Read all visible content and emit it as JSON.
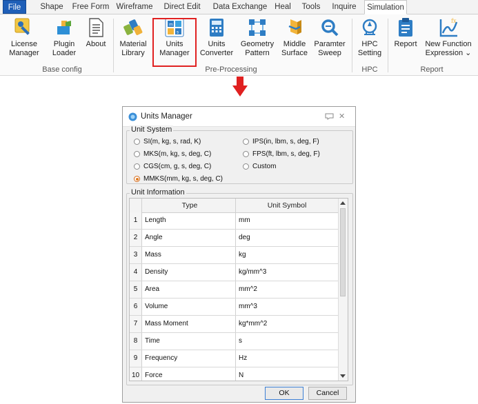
{
  "tabs": [
    "File",
    "Shape",
    "Free Form",
    "Wireframe",
    "Direct Edit",
    "Data Exchange",
    "Heal",
    "Tools",
    "Inquire",
    "Simulation"
  ],
  "active_tab": "Simulation",
  "ribbon": {
    "buttons": [
      {
        "name": "license-manager",
        "line1": "License",
        "line2": "Manager",
        "icon": "key-icon"
      },
      {
        "name": "plugin-loader",
        "line1": "Plugin",
        "line2": "Loader",
        "icon": "puzzle-icon"
      },
      {
        "name": "about",
        "line1": "About",
        "line2": "",
        "icon": "document-icon"
      },
      {
        "name": "material-library",
        "line1": "Material",
        "line2": "Library",
        "icon": "material-icon"
      },
      {
        "name": "units-manager",
        "line1": "Units",
        "line2": "Manager",
        "icon": "units-icon"
      },
      {
        "name": "units-converter",
        "line1": "Units",
        "line2": "Converter",
        "icon": "calculator-icon"
      },
      {
        "name": "geometry-pattern",
        "line1": "Geometry",
        "line2": "Pattern",
        "icon": "pattern-icon"
      },
      {
        "name": "middle-surface",
        "line1": "Middle",
        "line2": "Surface",
        "icon": "surface-icon"
      },
      {
        "name": "parameter-sweep",
        "line1": "Paramter",
        "line2": "Sweep",
        "icon": "sweep-icon"
      },
      {
        "name": "hpc-setting",
        "line1": "HPC",
        "line2": "Setting",
        "icon": "hpc-icon"
      },
      {
        "name": "report",
        "line1": "Report",
        "line2": "",
        "icon": "clipboard-icon"
      },
      {
        "name": "new-function-expression",
        "line1": "New Function",
        "line2": "Expression ⌄",
        "icon": "function-icon"
      }
    ],
    "groups": [
      "Base config",
      "Pre-Processing",
      "HPC",
      "Report"
    ]
  },
  "dialog": {
    "title": "Units Manager",
    "unit_system_title": "Unit System",
    "options": [
      {
        "label": "SI(m, kg, s, rad, K)",
        "selected": false
      },
      {
        "label": "IPS(in, lbm, s, deg, F)",
        "selected": false
      },
      {
        "label": "MKS(m, kg, s, deg, C)",
        "selected": false
      },
      {
        "label": "FPS(ft, lbm, s, deg, F)",
        "selected": false
      },
      {
        "label": "CGS(cm, g, s, deg, C)",
        "selected": false
      },
      {
        "label": "Custom",
        "selected": false
      },
      {
        "label": "MMKS(mm, kg, s, deg, C)",
        "selected": true
      }
    ],
    "unit_info_title": "Unit Information",
    "columns": [
      "Type",
      "Unit Symbol"
    ],
    "rows": [
      {
        "n": "1",
        "type": "Length",
        "symbol": "mm"
      },
      {
        "n": "2",
        "type": "Angle",
        "symbol": "deg"
      },
      {
        "n": "3",
        "type": "Mass",
        "symbol": "kg"
      },
      {
        "n": "4",
        "type": "Density",
        "symbol": "kg/mm^3"
      },
      {
        "n": "5",
        "type": "Area",
        "symbol": "mm^2"
      },
      {
        "n": "6",
        "type": "Volume",
        "symbol": "mm^3"
      },
      {
        "n": "7",
        "type": "Mass Moment",
        "symbol": "kg*mm^2"
      },
      {
        "n": "8",
        "type": "Time",
        "symbol": "s"
      },
      {
        "n": "9",
        "type": "Frequency",
        "symbol": "Hz"
      },
      {
        "n": "10",
        "type": "Force",
        "symbol": "N"
      }
    ],
    "ok_label": "OK",
    "cancel_label": "Cancel"
  },
  "colors": {
    "file_tab": "#1f5fb8",
    "highlight": "#e02020",
    "arrow": "#e02020",
    "radio_selected": "#e07a1e"
  }
}
